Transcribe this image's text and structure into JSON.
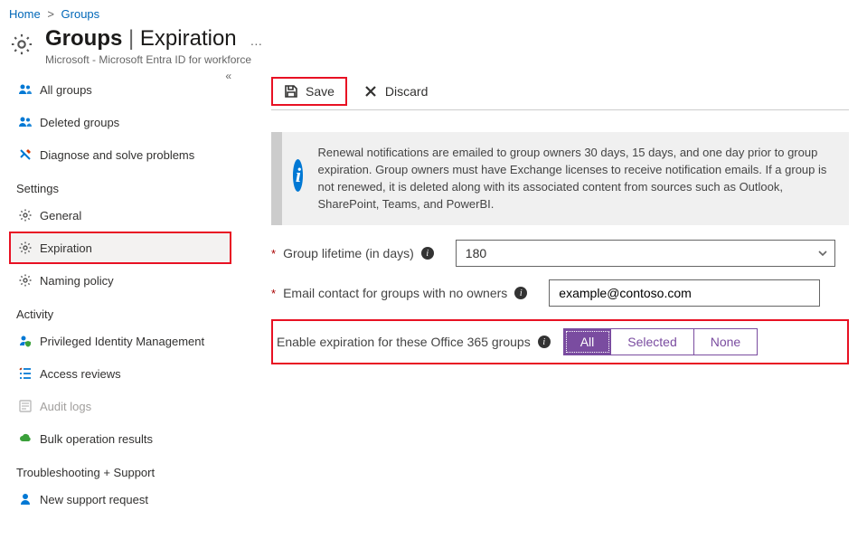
{
  "breadcrumb": {
    "home": "Home",
    "groups": "Groups"
  },
  "header": {
    "title_strong": "Groups",
    "title_light": "Expiration",
    "subtitle": "Microsoft - Microsoft Entra ID for workforce"
  },
  "sidebar": {
    "items": {
      "all_groups": "All groups",
      "deleted_groups": "Deleted groups",
      "diagnose": "Diagnose and solve problems"
    },
    "settings_label": "Settings",
    "settings": {
      "general": "General",
      "expiration": "Expiration",
      "naming": "Naming policy"
    },
    "activity_label": "Activity",
    "activity": {
      "pim": "Privileged Identity Management",
      "access": "Access reviews",
      "audit": "Audit logs",
      "bulk": "Bulk operation results"
    },
    "support_label": "Troubleshooting + Support",
    "support": {
      "new_request": "New support request"
    }
  },
  "toolbar": {
    "save": "Save",
    "discard": "Discard"
  },
  "notice": "Renewal notifications are emailed to group owners 30 days, 15 days, and one day prior to group expiration. Group owners must have Exchange licenses to receive notification emails. If a group is not renewed, it is deleted along with its associated content from sources such as Outlook, SharePoint, Teams, and PowerBI.",
  "form": {
    "lifetime_label": "Group lifetime (in days)",
    "lifetime_value": "180",
    "email_label": "Email contact for groups with no owners",
    "email_value": "example@contoso.com",
    "enable_label": "Enable expiration for these Office 365 groups",
    "options": {
      "all": "All",
      "selected": "Selected",
      "none": "None"
    }
  }
}
